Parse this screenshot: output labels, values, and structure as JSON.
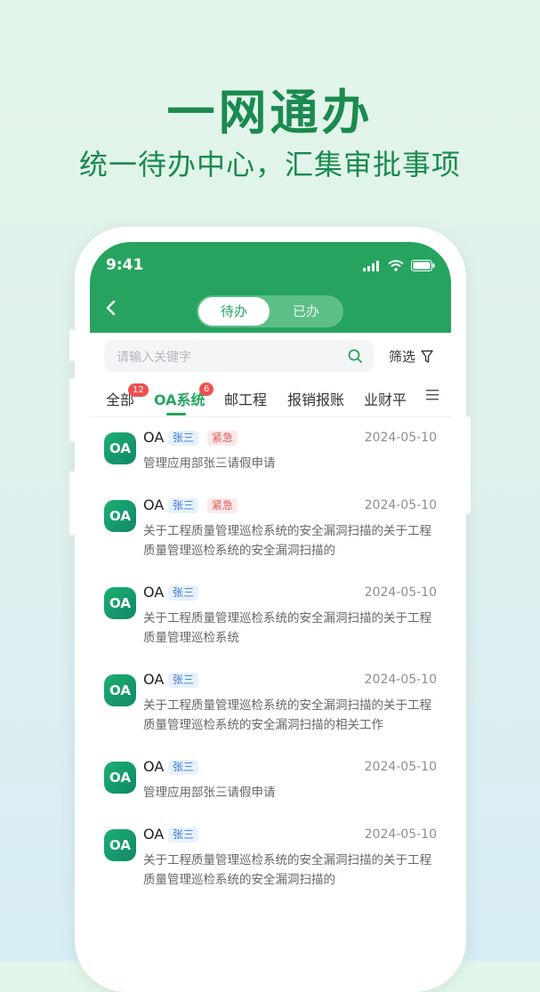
{
  "hero": {
    "title": "一网通办",
    "subtitle": "统一待办中心，汇集审批事项"
  },
  "status_bar": {
    "time": "9:41"
  },
  "header": {
    "segments": [
      "待办",
      "已办"
    ],
    "active_segment": "待办"
  },
  "search": {
    "placeholder": "请输入关键字",
    "filter_label": "筛选"
  },
  "tabs": [
    {
      "label": "全部",
      "badge": "12"
    },
    {
      "label": "OA系统",
      "badge": "6"
    },
    {
      "label": "邮工程",
      "badge": ""
    },
    {
      "label": "报销报账",
      "badge": ""
    },
    {
      "label": "业财平",
      "badge": ""
    }
  ],
  "items": [
    {
      "icon_text": "OA",
      "system": "OA",
      "user": "张三",
      "urgent": "紧急",
      "date": "2024-05-10",
      "desc": "管理应用部张三请假申请"
    },
    {
      "icon_text": "OA",
      "system": "OA",
      "user": "张三",
      "urgent": "紧急",
      "date": "2024-05-10",
      "desc": "关于工程质量管理巡检系统的安全漏洞扫描的关于工程质量管理巡检系统的安全漏洞扫描的"
    },
    {
      "icon_text": "OA",
      "system": "OA",
      "user": "张三",
      "urgent": "",
      "date": "2024-05-10",
      "desc": "关于工程质量管理巡检系统的安全漏洞扫描的关于工程质量管理巡检系统"
    },
    {
      "icon_text": "OA",
      "system": "OA",
      "user": "张三",
      "urgent": "",
      "date": "2024-05-10",
      "desc": "关于工程质量管理巡检系统的安全漏洞扫描的关于工程质量管理巡检系统的安全漏洞扫描的相关工作"
    },
    {
      "icon_text": "OA",
      "system": "OA",
      "user": "张三",
      "urgent": "",
      "date": "2024-05-10",
      "desc": "管理应用部张三请假申请"
    },
    {
      "icon_text": "OA",
      "system": "OA",
      "user": "张三",
      "urgent": "",
      "date": "2024-05-10",
      "desc": "关于工程质量管理巡检系统的安全漏洞扫描的关于工程质量管理巡检系统的安全漏洞扫描的"
    }
  ],
  "colors": {
    "primary": "#26a45f",
    "headline": "#1a8a4f",
    "badge": "#ef4f4f"
  }
}
